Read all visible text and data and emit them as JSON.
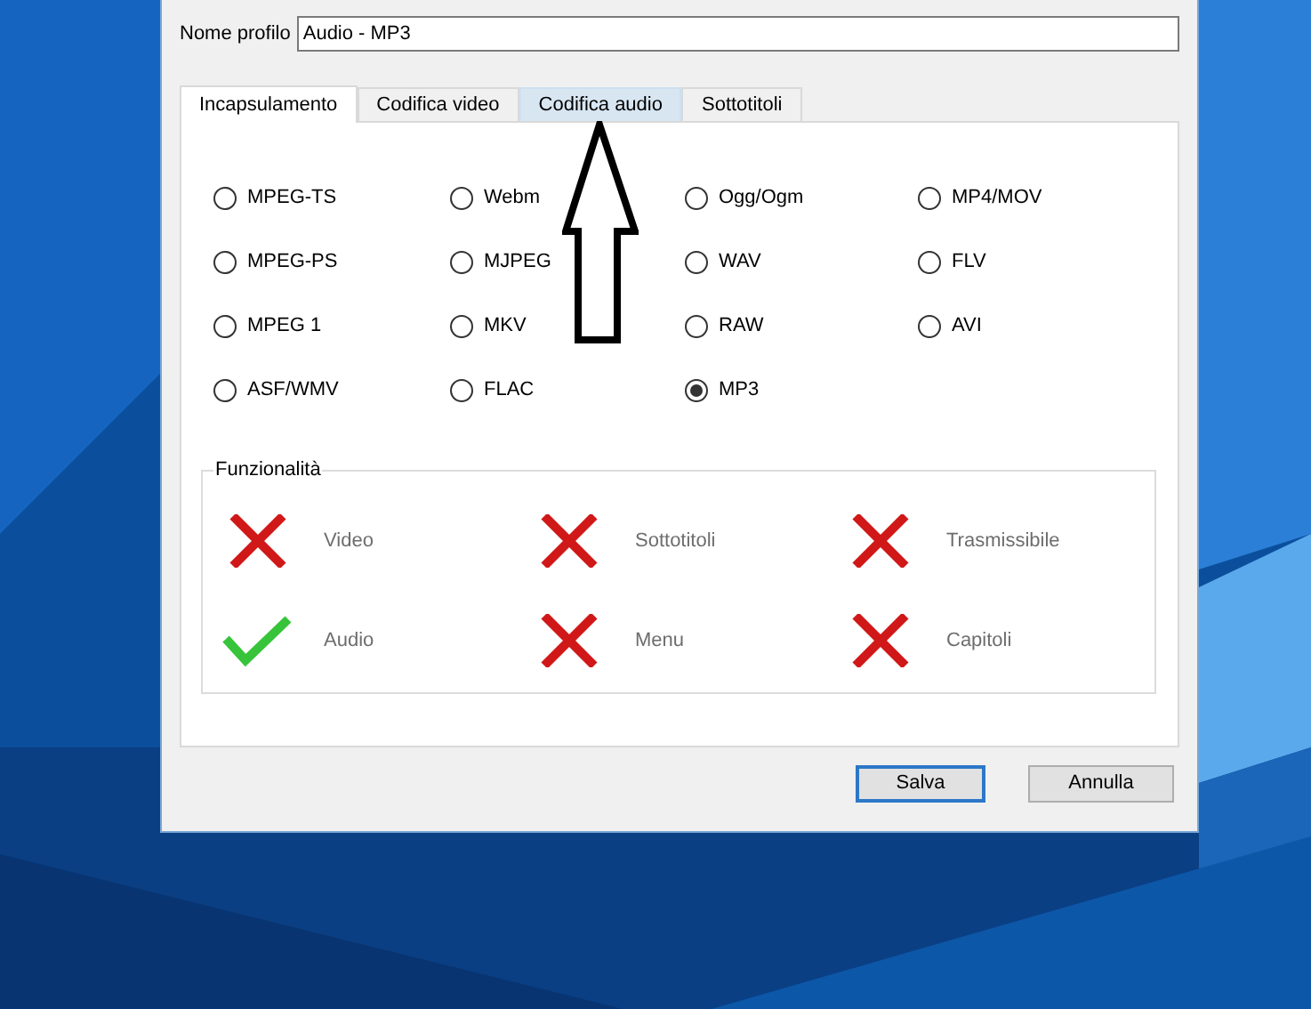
{
  "profile_name": {
    "label": "Nome profilo",
    "value": "Audio - MP3"
  },
  "tabs": [
    {
      "label": "Incapsulamento",
      "selected": true,
      "hovered": false
    },
    {
      "label": "Codifica video",
      "selected": false,
      "hovered": false
    },
    {
      "label": "Codifica audio",
      "selected": false,
      "hovered": true
    },
    {
      "label": "Sottotitoli",
      "selected": false,
      "hovered": false
    }
  ],
  "containers": [
    {
      "label": "MPEG-TS",
      "selected": false
    },
    {
      "label": "Webm",
      "selected": false
    },
    {
      "label": "Ogg/Ogm",
      "selected": false
    },
    {
      "label": "MP4/MOV",
      "selected": false
    },
    {
      "label": "MPEG-PS",
      "selected": false
    },
    {
      "label": "MJPEG",
      "selected": false
    },
    {
      "label": "WAV",
      "selected": false
    },
    {
      "label": "FLV",
      "selected": false
    },
    {
      "label": "MPEG 1",
      "selected": false
    },
    {
      "label": "MKV",
      "selected": false
    },
    {
      "label": "RAW",
      "selected": false
    },
    {
      "label": "AVI",
      "selected": false
    },
    {
      "label": "ASF/WMV",
      "selected": false
    },
    {
      "label": "FLAC",
      "selected": false
    },
    {
      "label": "MP3",
      "selected": true
    }
  ],
  "features": {
    "title": "Funzionalità",
    "items": [
      {
        "label": "Video",
        "supported": false
      },
      {
        "label": "Sottotitoli",
        "supported": false
      },
      {
        "label": "Trasmissibile",
        "supported": false
      },
      {
        "label": "Audio",
        "supported": true
      },
      {
        "label": "Menu",
        "supported": false
      },
      {
        "label": "Capitoli",
        "supported": false
      }
    ]
  },
  "buttons": [
    {
      "label": "Salva",
      "default": true
    },
    {
      "label": "Annulla",
      "default": false
    }
  ]
}
